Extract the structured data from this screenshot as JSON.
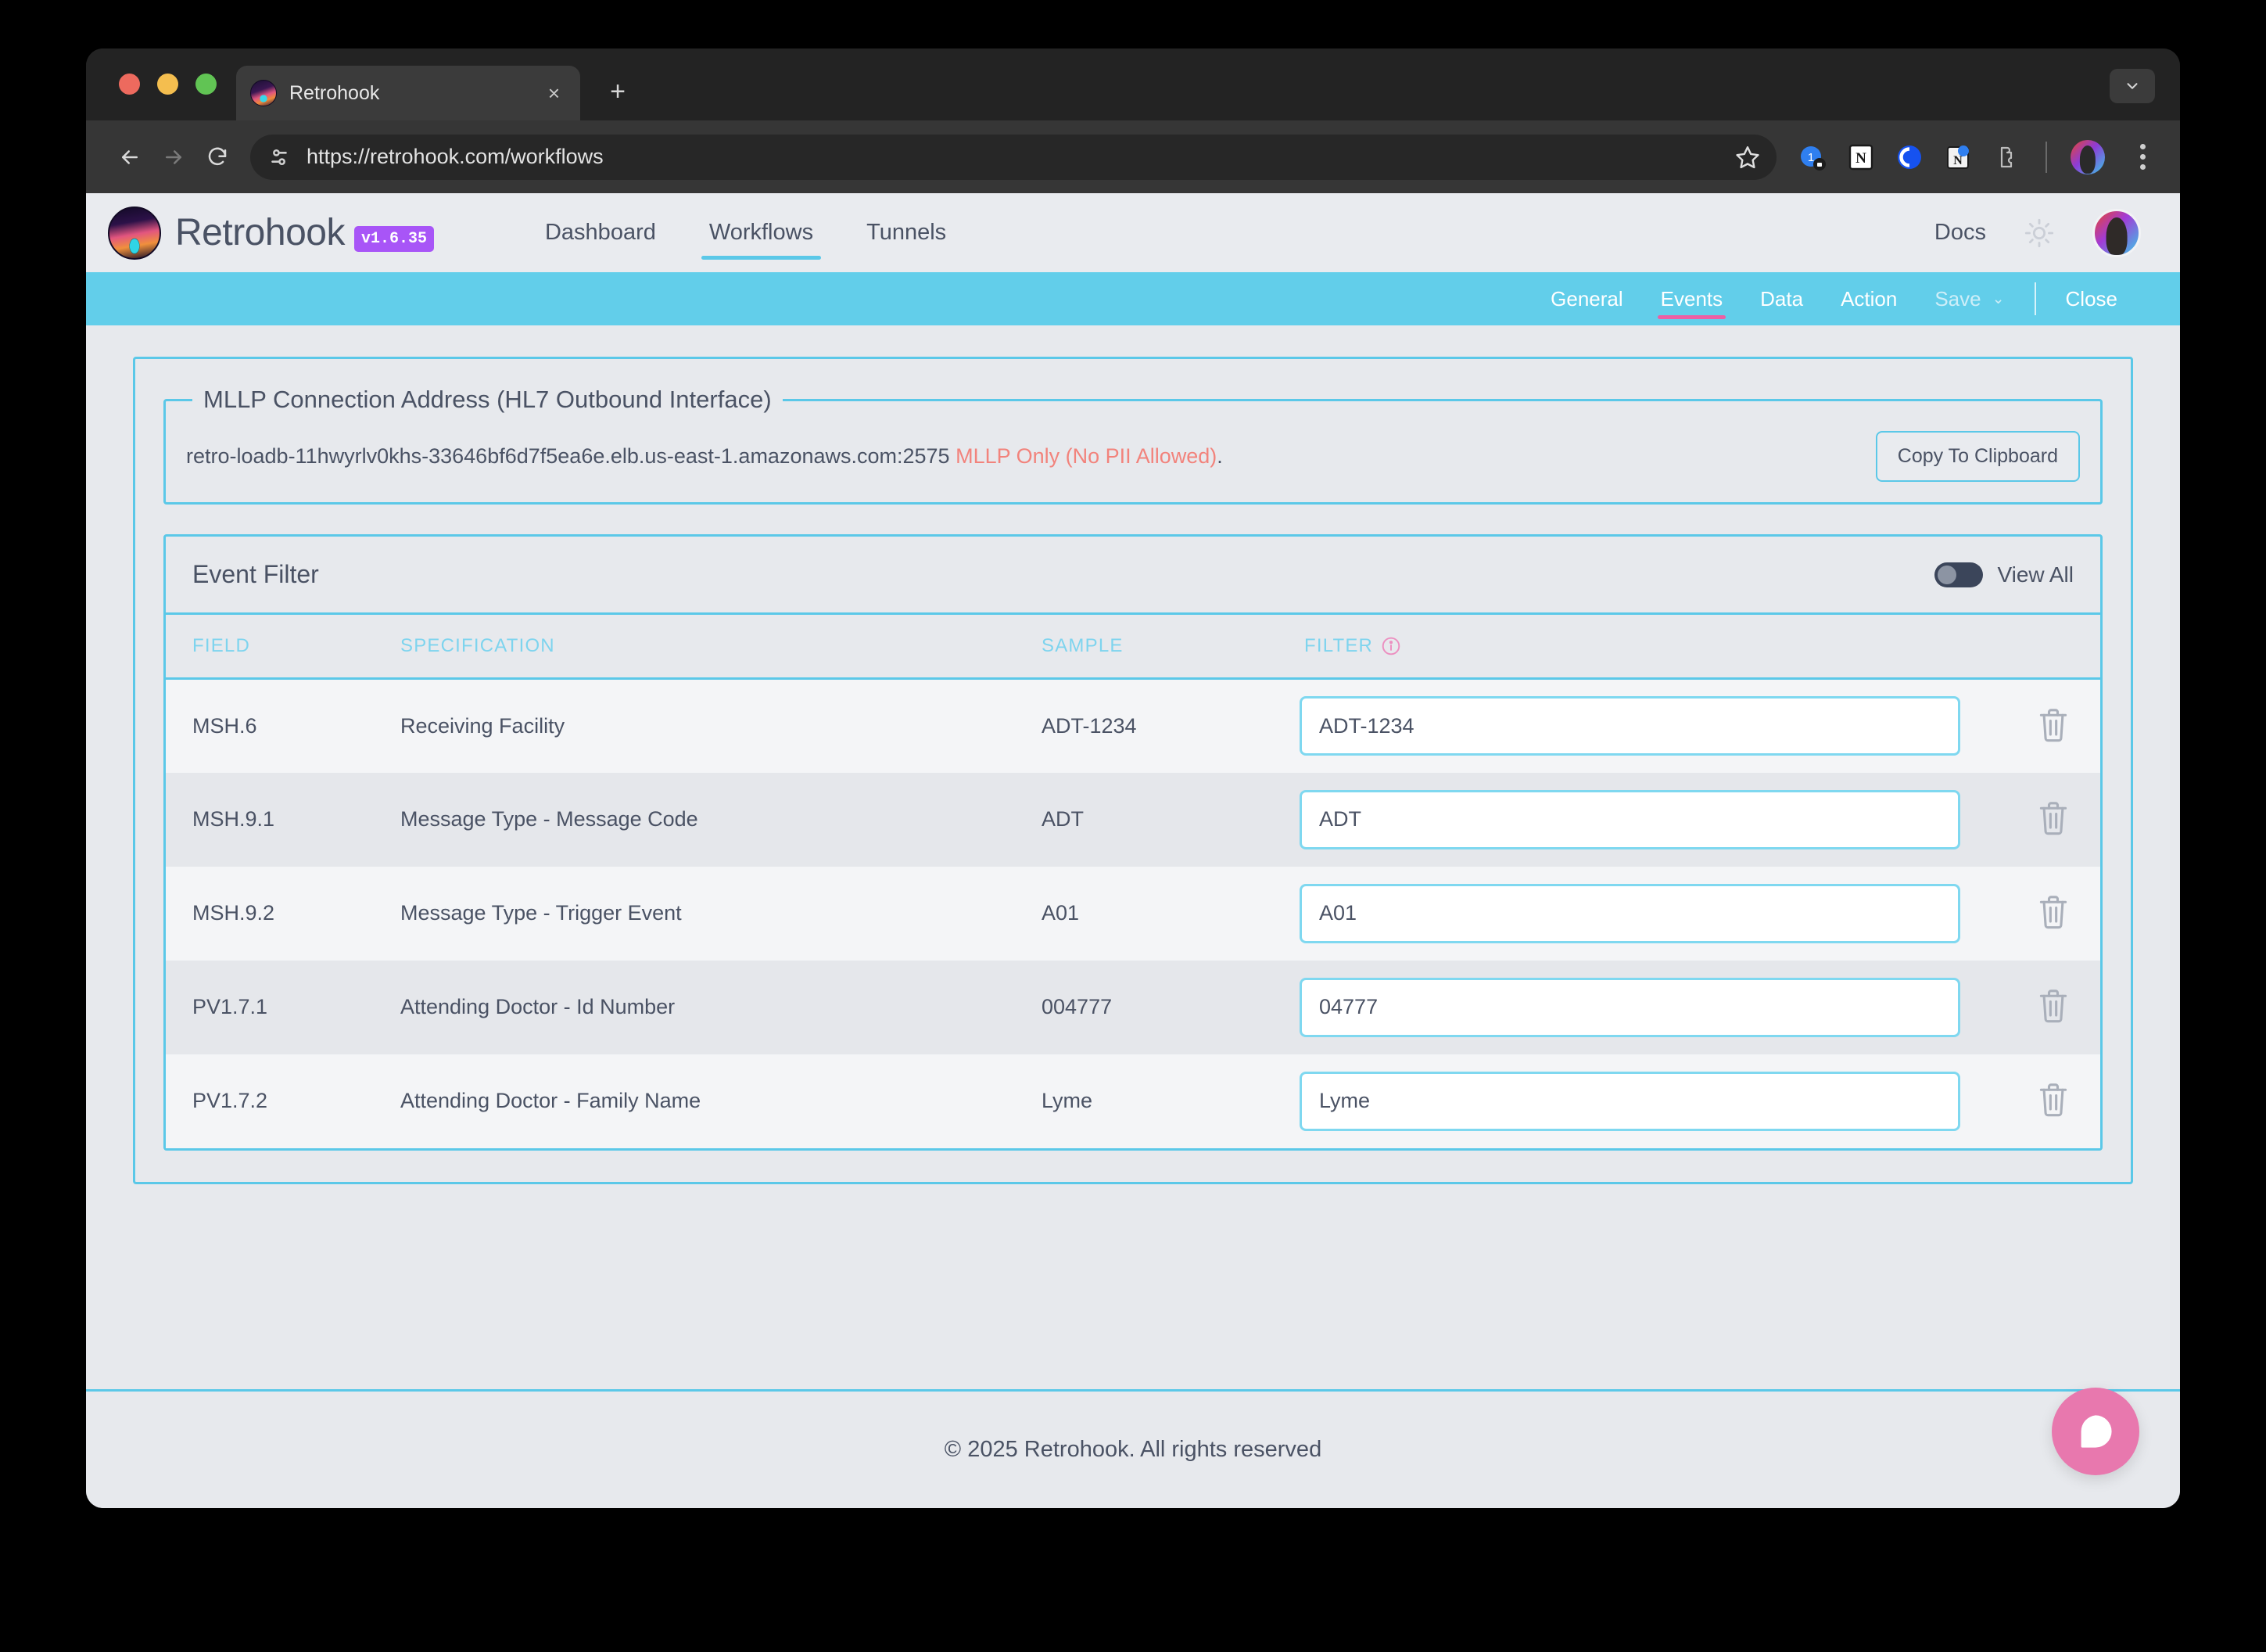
{
  "browser": {
    "tab": {
      "title": "Retrohook",
      "favicon": "retrohook-logo-icon",
      "close": "×"
    },
    "new_tab": "+",
    "url": "https://retrohook.com/workflows",
    "nav": {
      "back": "back-arrow-icon",
      "forward": "forward-arrow-icon",
      "reload": "reload-icon"
    },
    "icons": {
      "site_settings": "site-settings-icon",
      "bookmark": "bookmark-star-icon",
      "extensions": [
        "onepassword-extension-icon",
        "notion-extension-icon",
        "coinbase-extension-icon",
        "notion-web-clipper-icon",
        "puzzle-extensions-icon"
      ],
      "profile": "profile-avatar",
      "menu": "three-dot-menu-icon",
      "tab_list": "tab-list-chevron-icon"
    }
  },
  "app": {
    "brand_name": "Retrohook",
    "version": "v1.6.35",
    "nav_tabs": [
      {
        "label": "Dashboard",
        "active": false
      },
      {
        "label": "Workflows",
        "active": true
      },
      {
        "label": "Tunnels",
        "active": false
      }
    ],
    "docs_label": "Docs",
    "theme_toggle": "sun-icon"
  },
  "sub_toolbar": {
    "tabs": [
      {
        "label": "General",
        "active": false,
        "disabled": false
      },
      {
        "label": "Events",
        "active": true,
        "disabled": false
      },
      {
        "label": "Data",
        "active": false,
        "disabled": false
      },
      {
        "label": "Action",
        "active": false,
        "disabled": false
      }
    ],
    "save_label": "Save",
    "save_chevron": "⌄",
    "close_label": "Close"
  },
  "mllp": {
    "legend": "MLLP Connection Address (HL7 Outbound Interface)",
    "address": "retro-loadb-11hwyrlv0khs-33646bf6d7f5ea6e.elb.us-east-1.amazonaws.com:2575",
    "warning": "MLLP Only (No PII Allowed)",
    "period": ".",
    "copy_button": "Copy To Clipboard"
  },
  "event_filter": {
    "title": "Event Filter",
    "view_all_label": "View All",
    "view_all_enabled": false,
    "columns": {
      "field": "FIELD",
      "specification": "SPECIFICATION",
      "sample": "SAMPLE",
      "filter": "FILTER"
    },
    "rows": [
      {
        "field": "MSH.6",
        "specification": "Receiving Facility",
        "sample": "ADT-1234",
        "filter": "ADT-1234"
      },
      {
        "field": "MSH.9.1",
        "specification": "Message Type - Message Code",
        "sample": "ADT",
        "filter": "ADT"
      },
      {
        "field": "MSH.9.2",
        "specification": "Message Type - Trigger Event",
        "sample": "A01",
        "filter": "A01"
      },
      {
        "field": "PV1.7.1",
        "specification": "Attending Doctor - Id Number",
        "sample": "004777",
        "filter": "04777"
      },
      {
        "field": "PV1.7.2",
        "specification": "Attending Doctor - Family Name",
        "sample": "Lyme",
        "filter": "Lyme"
      }
    ]
  },
  "footer": {
    "text": "© 2025 Retrohook. All rights reserved"
  },
  "chat": {
    "icon": "chat-bubble-icon"
  },
  "colors": {
    "cyan_border": "#5BC8E8",
    "cyan_bar": "#62CEEA",
    "pink_accent": "#EC5FA4",
    "warning_red": "#F2837C",
    "purple_badge": "#A855F7",
    "text_slate": "#4A5264",
    "page_bg": "#E7E9ED",
    "chat_pink": "#E878AE"
  }
}
